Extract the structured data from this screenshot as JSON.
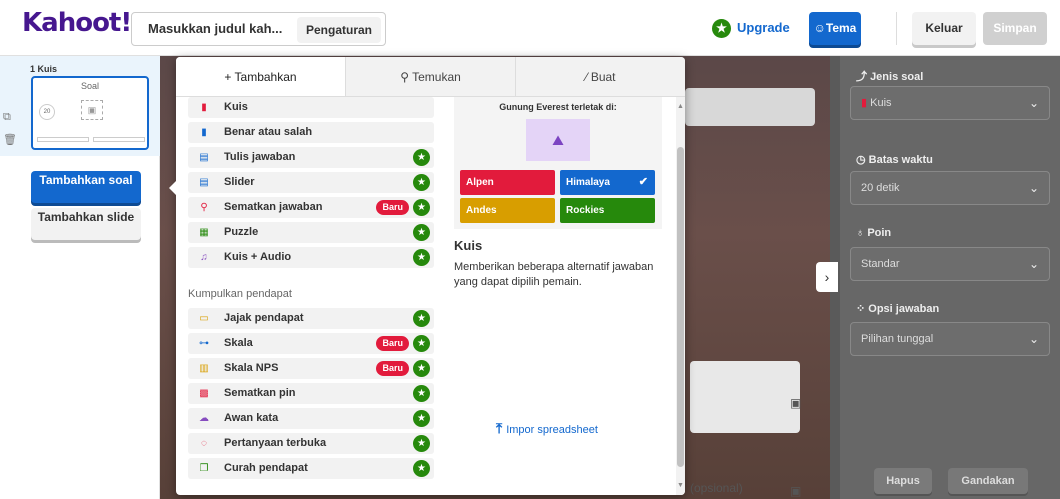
{
  "header": {
    "logo": "Kahoot!",
    "title_placeholder": "Masukkan judul kah...",
    "settings_label": "Pengaturan",
    "upgrade_label": "Upgrade",
    "theme_label": "Tema",
    "exit_label": "Keluar",
    "save_label": "Simpan"
  },
  "sidebar": {
    "slide_label": "1  Kuis",
    "thumb_title": "Soal",
    "thumb_timer": "20",
    "add_question": "Tambahkan soal",
    "add_slide": "Tambahkan slide"
  },
  "modal": {
    "tabs": [
      {
        "label": "Tambahkan",
        "icon": "plus-icon",
        "active": true
      },
      {
        "label": "Temukan",
        "icon": "search-icon",
        "active": false
      },
      {
        "label": "Buat",
        "icon": "magic-wand-icon",
        "active": false
      }
    ],
    "items": [
      {
        "label": "Kuis",
        "icon": "quiz-icon",
        "color": "#e21b3c",
        "premium": false,
        "new": false
      },
      {
        "label": "Benar atau salah",
        "icon": "true-false-icon",
        "color": "#1368ce",
        "premium": false,
        "new": false
      },
      {
        "label": "Tulis jawaban",
        "icon": "type-answer-icon",
        "color": "#1368ce",
        "premium": true,
        "new": false
      },
      {
        "label": "Slider",
        "icon": "slider-icon",
        "color": "#1368ce",
        "premium": true,
        "new": false
      },
      {
        "label": "Sematkan jawaban",
        "icon": "pin-answer-icon",
        "color": "#e21b3c",
        "premium": true,
        "new": true
      },
      {
        "label": "Puzzle",
        "icon": "puzzle-icon",
        "color": "#26890c",
        "premium": true,
        "new": false
      },
      {
        "label": "Kuis + Audio",
        "icon": "quiz-audio-icon",
        "color": "#864cbf",
        "premium": true,
        "new": false
      }
    ],
    "section_label": "Kumpulkan pendapat",
    "items2": [
      {
        "label": "Jajak pendapat",
        "icon": "poll-icon",
        "color": "#d89e00",
        "premium": true,
        "new": false
      },
      {
        "label": "Skala",
        "icon": "scale-icon",
        "color": "#1368ce",
        "premium": true,
        "new": true
      },
      {
        "label": "Skala NPS",
        "icon": "nps-scale-icon",
        "color": "#d89e00",
        "premium": true,
        "new": true
      },
      {
        "label": "Sematkan pin",
        "icon": "drop-pin-icon",
        "color": "#e21b3c",
        "premium": true,
        "new": false
      },
      {
        "label": "Awan kata",
        "icon": "word-cloud-icon",
        "color": "#864cbf",
        "premium": true,
        "new": false
      },
      {
        "label": "Pertanyaan terbuka",
        "icon": "open-ended-icon",
        "color": "#e21b3c",
        "premium": true,
        "new": false
      },
      {
        "label": "Curah pendapat",
        "icon": "brainstorm-icon",
        "color": "#26890c",
        "premium": true,
        "new": false
      }
    ],
    "new_badge": "Baru",
    "preview": {
      "question": "Gunung Everest terletak di:",
      "answers": [
        {
          "text": "Alpen",
          "color": "#e21b3c",
          "correct": false
        },
        {
          "text": "Himalaya",
          "color": "#1368ce",
          "correct": true
        },
        {
          "text": "Andes",
          "color": "#d89e00",
          "correct": false
        },
        {
          "text": "Rockies",
          "color": "#26890c",
          "correct": false
        }
      ]
    },
    "desc_title": "Kuis",
    "desc_text": "Memberikan beberapa alternatif jawaban yang dapat dipilih pemain.",
    "import_label": "Impor spreadsheet"
  },
  "canvas": {
    "optional_hint": "(opsional)"
  },
  "right": {
    "type_label": "Jenis soal",
    "type_value": "Kuis",
    "time_label": "Batas waktu",
    "time_value": "20 detik",
    "points_label": "Poin",
    "points_value": "Standar",
    "answer_opts_label": "Opsi jawaban",
    "answer_opts_value": "Pilihan tunggal",
    "delete_label": "Hapus",
    "duplicate_label": "Gandakan"
  },
  "colors": {
    "brand": "#46178f",
    "accent": "#1368ce",
    "premium": "#26890c",
    "new": "#e21b3c"
  }
}
